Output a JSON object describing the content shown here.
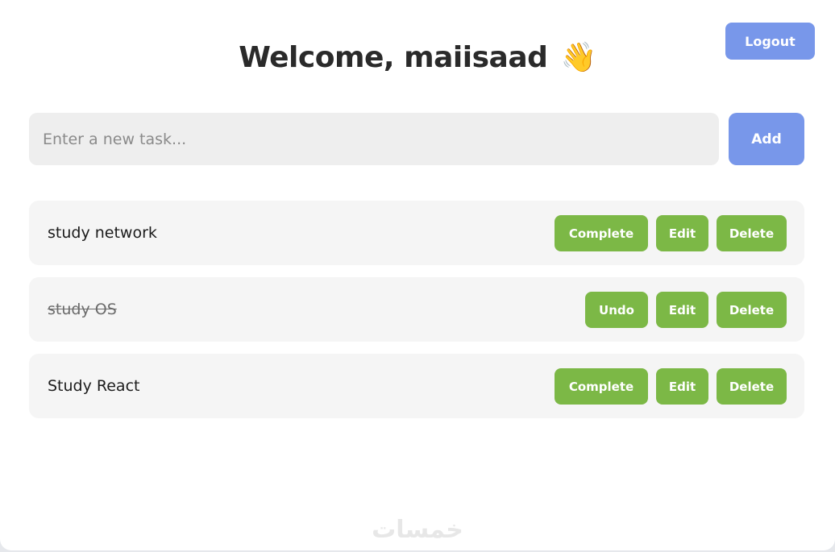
{
  "header": {
    "welcome_title": "Welcome, maiisaad",
    "wave_emoji": "👋",
    "logout_label": "Logout"
  },
  "new_task": {
    "placeholder": "Enter a new task...",
    "value": "",
    "add_label": "Add"
  },
  "tasks": [
    {
      "text": "study network",
      "completed": false,
      "toggle_label": "Complete",
      "edit_label": "Edit",
      "delete_label": "Delete"
    },
    {
      "text": "study OS",
      "completed": true,
      "toggle_label": "Undo",
      "edit_label": "Edit",
      "delete_label": "Delete"
    },
    {
      "text": "Study React",
      "completed": false,
      "toggle_label": "Complete",
      "edit_label": "Edit",
      "delete_label": "Delete"
    }
  ],
  "watermark": "خمسات",
  "colors": {
    "primary": "#7897ea",
    "action_green": "#7cb846",
    "task_bg": "#f5f5f5",
    "input_bg": "#eeeeee"
  }
}
